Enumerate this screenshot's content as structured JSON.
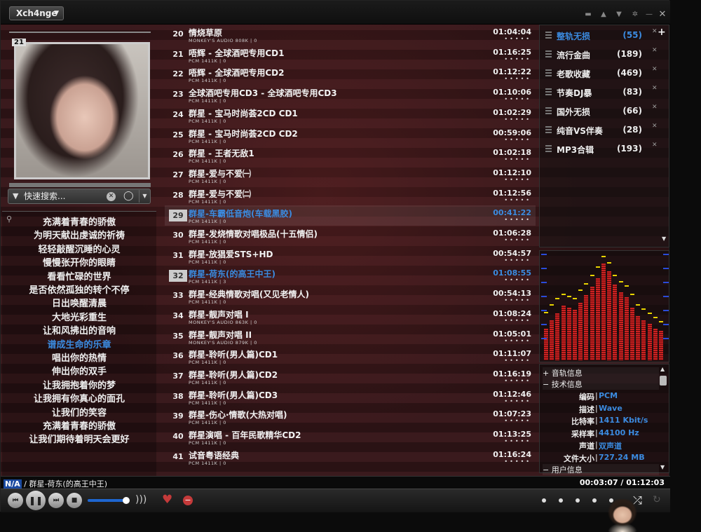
{
  "app": {
    "logo_label": "Xch4nge"
  },
  "cover": {
    "badge_number": "21"
  },
  "search": {
    "placeholder": "快速搜索..."
  },
  "lyrics": {
    "lines": [
      "充满着青春的骄傲",
      "为明天献出虔诚的祈祷",
      "轻轻敲醒沉睡的心灵",
      "慢慢张开你的眼睛",
      "看看忙碌的世界",
      "是否依然孤独的转个不停",
      "日出唤醒清晨",
      "大地光彩重生",
      "让和风拂出的音响",
      "谱成生命的乐章",
      "唱出你的热情",
      "伸出你的双手",
      "让我拥抱着你的梦",
      "让我拥有你真心的面孔",
      "让我们的笑容",
      "充满着青春的骄傲",
      "让我们期待着明天会更好"
    ],
    "active_index": 9
  },
  "playlist": {
    "rows": [
      {
        "num": "20",
        "title": "情烧草原",
        "meta": "MONKEY'S AUDIO 808K | 0",
        "duration": "01:04:04"
      },
      {
        "num": "21",
        "title": "唔辉 - 全球酒吧专用CD1",
        "meta": "PCM 1411K | 0",
        "duration": "01:16:25"
      },
      {
        "num": "22",
        "title": "唔辉 - 全球酒吧专用CD2",
        "meta": "PCM 1411K | 0",
        "duration": "01:12:22"
      },
      {
        "num": "23",
        "title": "全球酒吧专用CD3 - 全球酒吧专用CD3",
        "meta": "PCM 1411K | 0",
        "duration": "01:10:06"
      },
      {
        "num": "24",
        "title": "群星 - 宝马时尚荟2CD CD1",
        "meta": "PCM 1411K | 0",
        "duration": "01:02:29"
      },
      {
        "num": "25",
        "title": "群星 - 宝马时尚荟2CD CD2",
        "meta": "PCM 1411K | 0",
        "duration": "00:59:06"
      },
      {
        "num": "26",
        "title": "群星 - 王者无敌1",
        "meta": "PCM 1411K | 0",
        "duration": "01:02:18"
      },
      {
        "num": "27",
        "title": "群星-爱与不爱㈠",
        "meta": "PCM 1411K | 0",
        "duration": "01:12:10"
      },
      {
        "num": "28",
        "title": "群星-爱与不爱㈡",
        "meta": "PCM 1411K | 0",
        "duration": "01:12:56"
      },
      {
        "num": "29",
        "title": "群星-车霸低音炮(车载黑胶)",
        "meta": "PCM 1411K | 0",
        "duration": "00:41:22"
      },
      {
        "num": "30",
        "title": "群星-发烧情歌对唱极品(十五情侣)",
        "meta": "PCM 1411K | 0",
        "duration": "01:06:28"
      },
      {
        "num": "31",
        "title": "群星-放猖爱STS+HD",
        "meta": "PCM 1411K | 0",
        "duration": "00:54:57"
      },
      {
        "num": "32",
        "title": "群星-荷东(的高王中王)",
        "meta": "PCM 1411K | 3",
        "duration": "01:08:55"
      },
      {
        "num": "33",
        "title": "群星-经典情歌对唱(又见老情人)",
        "meta": "PCM 1411K | 0",
        "duration": "00:54:13"
      },
      {
        "num": "34",
        "title": "群星-靓声对唱 I",
        "meta": "MONKEY'S AUDIO 863K | 0",
        "duration": "01:08:24"
      },
      {
        "num": "35",
        "title": "群星-靓声对唱 II",
        "meta": "MONKEY'S AUDIO 879K | 0",
        "duration": "01:05:01"
      },
      {
        "num": "36",
        "title": "群星-聆听(男人篇)CD1",
        "meta": "PCM 1411K | 0",
        "duration": "01:11:07"
      },
      {
        "num": "37",
        "title": "群星-聆听(男人篇)CD2",
        "meta": "PCM 1411K | 0",
        "duration": "01:16:19"
      },
      {
        "num": "38",
        "title": "群星-聆听(男人篇)CD3",
        "meta": "PCM 1411K | 0",
        "duration": "01:12:46"
      },
      {
        "num": "39",
        "title": "群星-伤心·情歌(大热对唱)",
        "meta": "PCM 1411K | 0",
        "duration": "01:07:23"
      },
      {
        "num": "40",
        "title": "群星演唱 - 百年民歌精华CD2",
        "meta": "PCM 1411K | 0",
        "duration": "01:13:25"
      },
      {
        "num": "41",
        "title": "试音粤语经典",
        "meta": "PCM 1411K | 0",
        "duration": "01:16:24"
      }
    ],
    "rating_dots": "•••••"
  },
  "groups": {
    "items": [
      {
        "name": "整轨无损",
        "count": "(55)"
      },
      {
        "name": "流行金曲",
        "count": "(189)"
      },
      {
        "name": "老歌收藏",
        "count": "(469)"
      },
      {
        "name": "节奏DJ暴",
        "count": "(83)"
      },
      {
        "name": "国外无损",
        "count": "(66)"
      },
      {
        "name": "纯音VS伴奏",
        "count": "(28)"
      },
      {
        "name": "MP3合辑",
        "count": "(193)"
      }
    ],
    "active_index": 0
  },
  "spectrum": {
    "levels": [
      0.3,
      0.38,
      0.45,
      0.52,
      0.5,
      0.48,
      0.55,
      0.62,
      0.7,
      0.78,
      0.92,
      0.85,
      0.72,
      0.65,
      0.6,
      0.5,
      0.42,
      0.38,
      0.35,
      0.3,
      0.28
    ],
    "peaks": [
      0.45,
      0.52,
      0.58,
      0.62,
      0.6,
      0.58,
      0.66,
      0.72,
      0.8,
      0.88,
      0.98,
      0.92,
      0.8,
      0.74,
      0.7,
      0.62,
      0.52,
      0.48,
      0.44,
      0.4,
      0.36
    ]
  },
  "info": {
    "track_info_label": "+ 音轨信息",
    "tech_info_label": "− 技术信息",
    "user_info_label": "− 用户信息",
    "fields": [
      {
        "label": "编码",
        "value": "PCM"
      },
      {
        "label": "描述",
        "value": "Wave"
      },
      {
        "label": "比特率",
        "value": "1411 Kbit/s"
      },
      {
        "label": "采样率",
        "value": "44100 Hz"
      },
      {
        "label": "声道",
        "value": "双声道"
      },
      {
        "label": "文件大小",
        "value": "727.24 MB"
      }
    ]
  },
  "status": {
    "na_label": "N/A",
    "now_playing": " / 群星-荷东(的高王中王)",
    "time": "00:03:07 / 01:12:03"
  },
  "colors": {
    "accent": "#3b8be0",
    "love": "#c43a3a",
    "bar": "#cc2222",
    "peak": "#e8d400"
  }
}
